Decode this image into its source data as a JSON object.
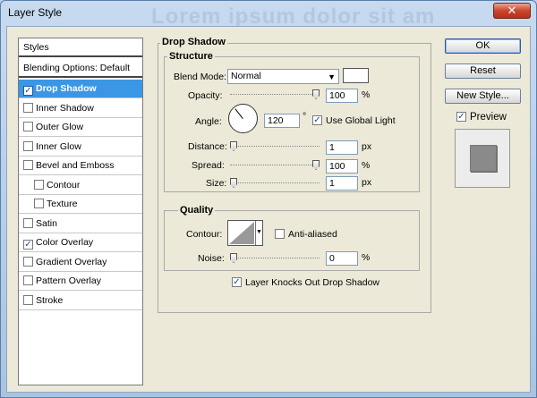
{
  "window": {
    "title": "Layer Style",
    "ghost_text": "Lorem ipsum dolor sit am"
  },
  "style_list": {
    "header": "Styles",
    "blending": "Blending Options: Default",
    "items": [
      {
        "label": "Drop Shadow",
        "checked": true,
        "selected": true
      },
      {
        "label": "Inner Shadow",
        "checked": false
      },
      {
        "label": "Outer Glow",
        "checked": false
      },
      {
        "label": "Inner Glow",
        "checked": false
      },
      {
        "label": "Bevel and Emboss",
        "checked": false
      },
      {
        "label": "Contour",
        "checked": false,
        "indent": true
      },
      {
        "label": "Texture",
        "checked": false,
        "indent": true
      },
      {
        "label": "Satin",
        "checked": false
      },
      {
        "label": "Color Overlay",
        "checked": true
      },
      {
        "label": "Gradient Overlay",
        "checked": false
      },
      {
        "label": "Pattern Overlay",
        "checked": false
      },
      {
        "label": "Stroke",
        "checked": false
      }
    ]
  },
  "drop_shadow": {
    "title": "Drop Shadow",
    "structure": {
      "title": "Structure",
      "blend_mode_label": "Blend Mode:",
      "blend_mode_value": "Normal",
      "opacity_label": "Opacity:",
      "opacity_value": "100",
      "opacity_unit": "%",
      "angle_label": "Angle:",
      "angle_value": "120",
      "angle_unit": "°",
      "use_global_light": "Use Global Light",
      "distance_label": "Distance:",
      "distance_value": "1",
      "distance_unit": "px",
      "spread_label": "Spread:",
      "spread_value": "100",
      "spread_unit": "%",
      "size_label": "Size:",
      "size_value": "1",
      "size_unit": "px"
    },
    "quality": {
      "title": "Quality",
      "contour_label": "Contour:",
      "anti_aliased": "Anti-aliased",
      "noise_label": "Noise:",
      "noise_value": "0",
      "noise_unit": "%"
    },
    "knockout": "Layer Knocks Out Drop Shadow"
  },
  "buttons": {
    "ok": "OK",
    "reset": "Reset",
    "new_style": "New Style...",
    "preview": "Preview"
  },
  "colors": {
    "selection": "#3b97e6",
    "dialog_bg": "#ece9d8",
    "preview_swatch": "#8a8a8a"
  }
}
